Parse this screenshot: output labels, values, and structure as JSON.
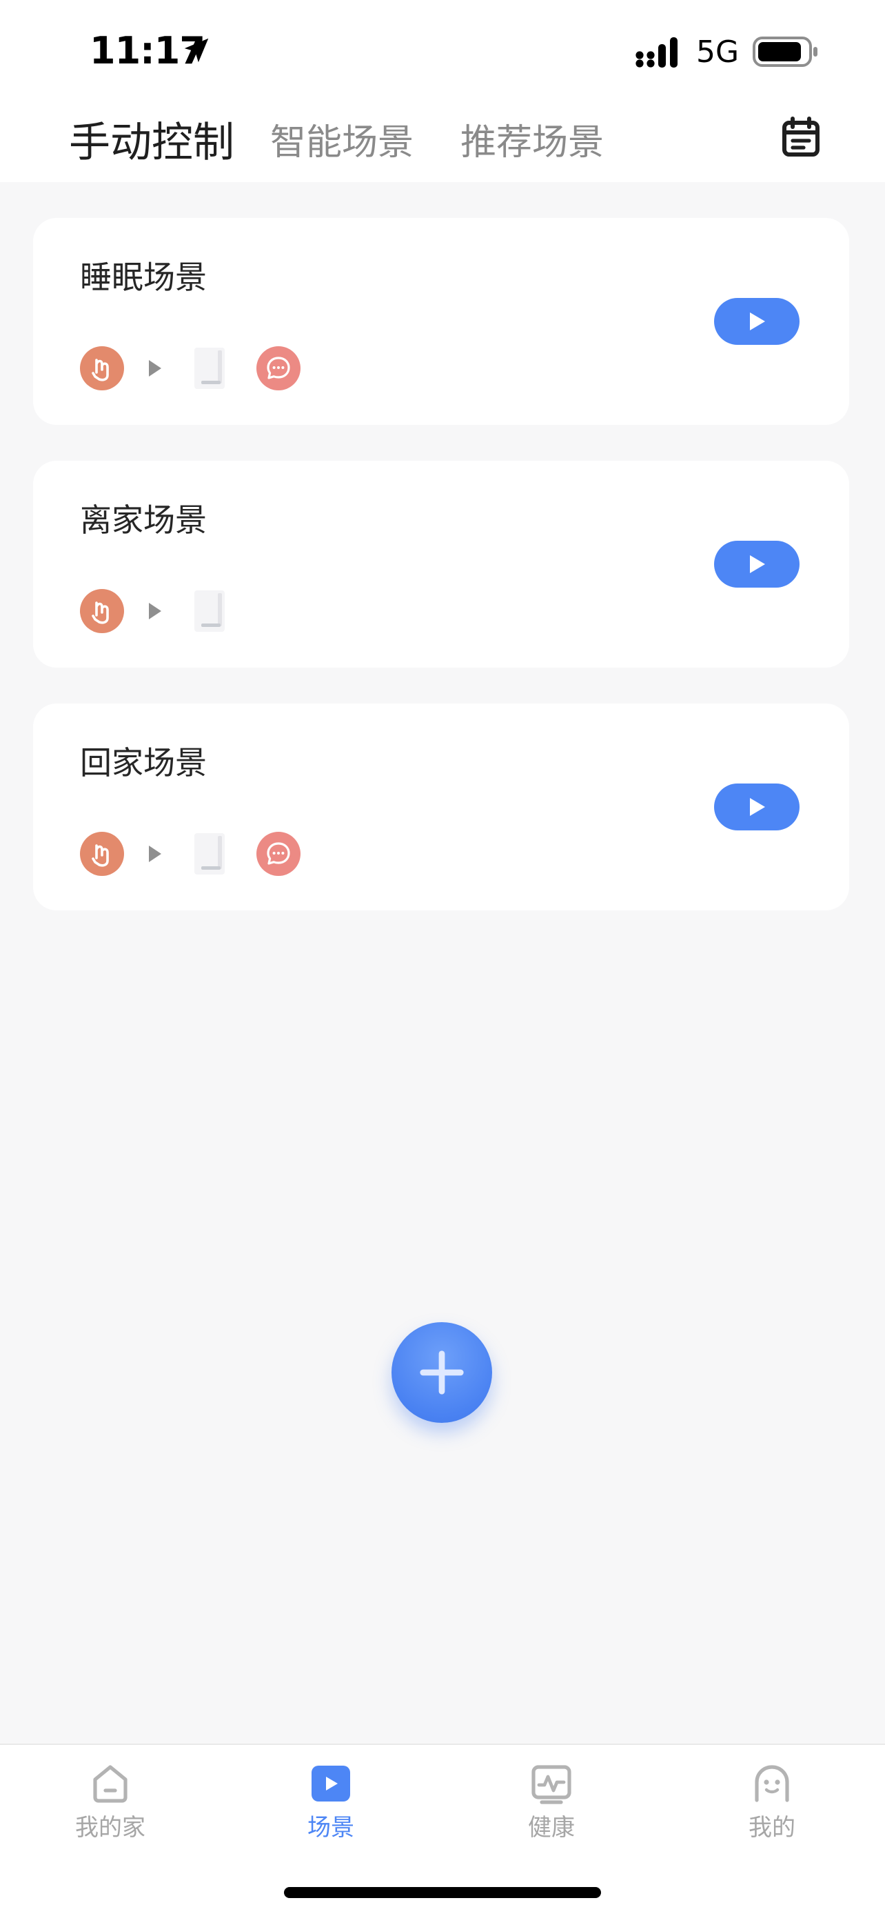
{
  "status_bar": {
    "time": "11:17",
    "network": "5G",
    "icons": [
      "location-arrow-icon",
      "signal-icon",
      "battery-icon"
    ]
  },
  "header": {
    "tabs": [
      {
        "label": "手动控制",
        "active": true
      },
      {
        "label": "智能场景",
        "active": false
      },
      {
        "label": "推荐场景",
        "active": false
      }
    ],
    "action_icon": "calendar-icon"
  },
  "scenes": [
    {
      "title": "睡眠场景",
      "icons": [
        "hand-tap-icon",
        "arrow-right-icon",
        "device-icon",
        "chat-icon"
      ]
    },
    {
      "title": "离家场景",
      "icons": [
        "hand-tap-icon",
        "arrow-right-icon",
        "device-icon"
      ]
    },
    {
      "title": "回家场景",
      "icons": [
        "hand-tap-icon",
        "arrow-right-icon",
        "device-icon",
        "chat-icon"
      ]
    }
  ],
  "fab_icon": "plus-icon",
  "bottom_nav": {
    "items": [
      {
        "label": "我的家",
        "icon": "home-icon",
        "active": false
      },
      {
        "label": "场景",
        "icon": "scene-play-icon",
        "active": true
      },
      {
        "label": "健康",
        "icon": "health-icon",
        "active": false
      },
      {
        "label": "我的",
        "icon": "profile-icon",
        "active": false
      }
    ]
  },
  "colors": {
    "accent": "#4d86f5",
    "hand_icon": "#e38a6c",
    "chat_icon": "#ec8a84",
    "background": "#f7f7f8"
  }
}
